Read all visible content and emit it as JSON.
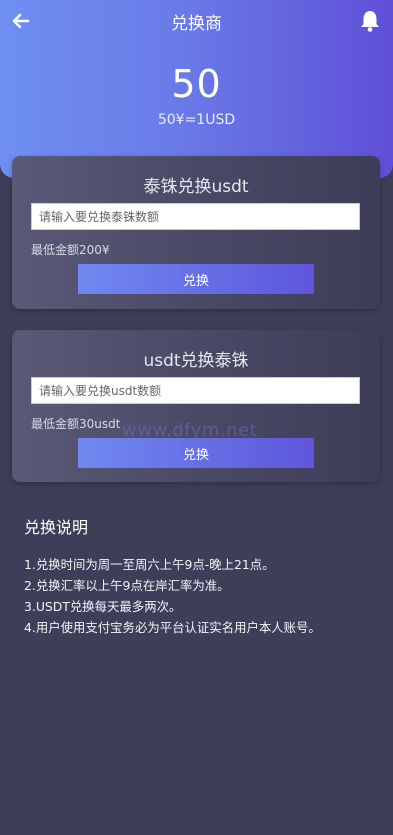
{
  "header": {
    "title": "兑换商",
    "rate_value": "50",
    "rate_text": "50¥=1USD",
    "back_icon": "back-arrow-icon",
    "bell_icon": "bell-icon"
  },
  "cards": [
    {
      "title": "泰铢兑换usdt",
      "placeholder": "请输入要兑换泰铢数额",
      "min_text": "最低金额200¥",
      "button_label": "兑换"
    },
    {
      "title": "usdt兑换泰铢",
      "placeholder": "请输入要兑换usdt数额",
      "min_text": "最低金额30usdt",
      "button_label": "兑换"
    }
  ],
  "watermark": "www.dfym.net",
  "notes": {
    "title": "兑换说明",
    "items": [
      "1.兑换时间为周一至周六上午9点-晚上21点。",
      "2.兑换汇率以上午9点在岸汇率为准。",
      "3.USDT兑换每天最多两次。",
      "4.用户使用支付宝务必为平台认证实名用户本人账号。"
    ]
  },
  "colors": {
    "header_gradient_start": "#6f8ff3",
    "header_gradient_end": "#5f4fd8",
    "background": "#3f3e58",
    "button_gradient_start": "#6f89f0",
    "button_gradient_end": "#5f56dc"
  }
}
